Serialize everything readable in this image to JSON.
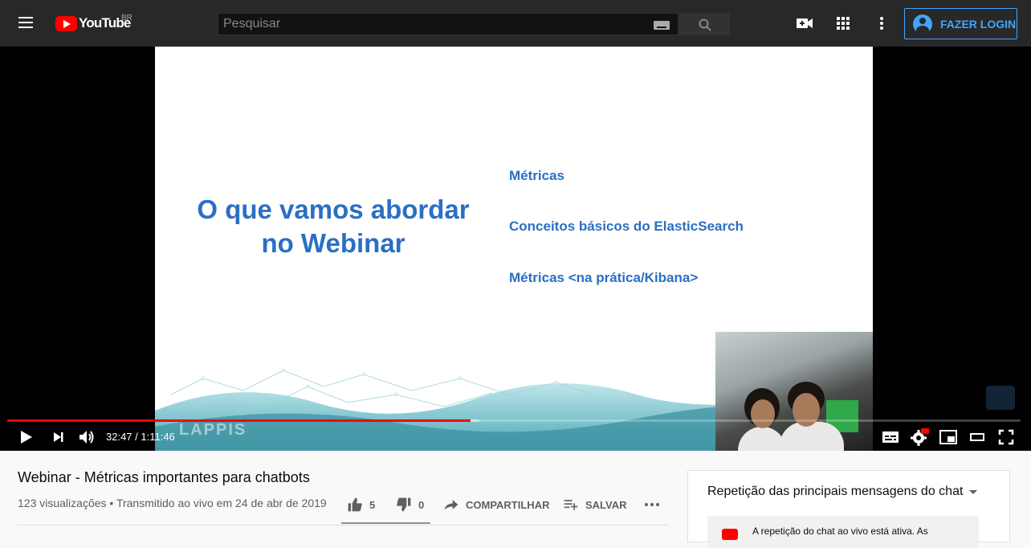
{
  "masthead": {
    "logo_text": "YouTube",
    "country_code": "BR",
    "search_placeholder": "Pesquisar",
    "login_label": "FAZER LOGIN",
    "icons": [
      "menu-icon",
      "keyboard-icon",
      "search-icon",
      "create-video-icon",
      "apps-grid-icon",
      "more-vert-icon",
      "account-icon"
    ]
  },
  "slide": {
    "title_line1": "O que vamos abordar",
    "title_line2": "no Webinar",
    "items": [
      "Métricas",
      "Conceitos básicos do ElasticSearch",
      "Métricas <na prática/Kibana>"
    ],
    "footer_logo": "LAPPIS"
  },
  "player": {
    "current_time": "32:47",
    "duration": "1:11:46",
    "time_display": "32:47 / 1:11:46",
    "progress_played_fraction": 0.457,
    "progress_loaded_fraction": 0.466,
    "controls": [
      "play-icon",
      "next-icon",
      "volume-icon",
      "subtitles-icon",
      "settings-hd-icon",
      "miniplayer-icon",
      "theater-icon",
      "fullscreen-icon"
    ],
    "accent_color": "#ff0000"
  },
  "video": {
    "title": "Webinar - Métricas importantes para chatbots",
    "info": "123 visualizações • Transmitido ao vivo em 24 de abr de 2019",
    "likes": "5",
    "dislikes": "0",
    "share_label": "COMPARTILHAR",
    "save_label": "SALVAR"
  },
  "chat": {
    "header": "Repetição das principais mensagens do chat",
    "notice": "A repetição do chat ao vivo está ativa. As"
  }
}
